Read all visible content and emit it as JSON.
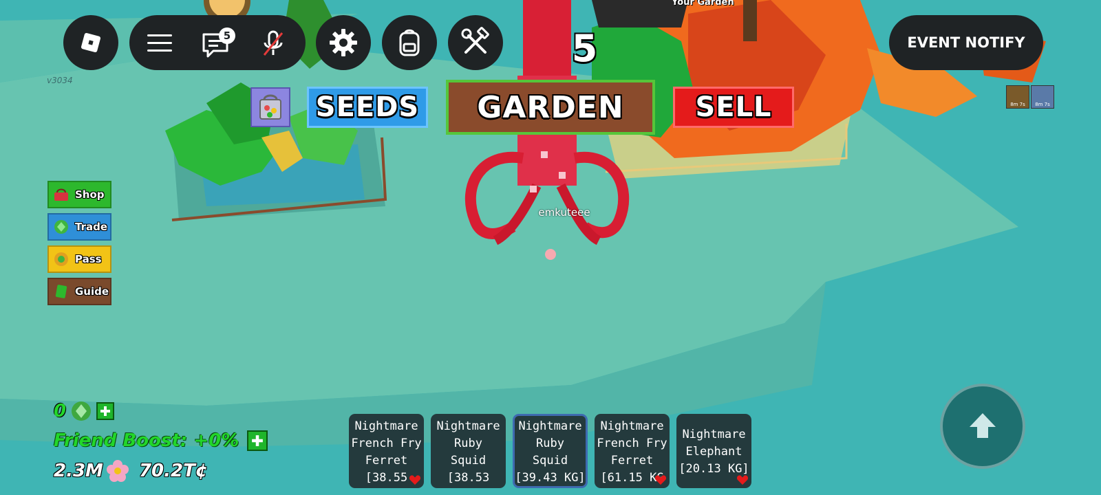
{
  "version": "v3034",
  "player_name": "emkuteee",
  "your_garden_label": "Your Garden",
  "count_display": "5",
  "chat_badge": "5",
  "event_notify_label": "EVENT NOTIFY",
  "nav": {
    "seeds": "SEEDS",
    "garden": "GARDEN",
    "sell": "SELL"
  },
  "side_menu": [
    {
      "label": "Shop",
      "icon": "basket-icon",
      "color": "#2db82d"
    },
    {
      "label": "Trade",
      "icon": "trade-icon",
      "color": "#2f8fd8"
    },
    {
      "label": "Pass",
      "icon": "pass-icon",
      "color": "#f2c316"
    },
    {
      "label": "Guide",
      "icon": "book-icon",
      "color": "#7a4a2c"
    }
  ],
  "stats": {
    "shecklets_token": "0",
    "friend_boost": "Friend Boost: +0%",
    "honey": "2.3M",
    "money": "70.2T¢"
  },
  "hotbar": [
    {
      "lines": [
        "Nightmare",
        "French Fry",
        "Ferret",
        "[38.55"
      ],
      "favorite": true,
      "selected": false
    },
    {
      "lines": [
        "Nightmare",
        "Ruby",
        "Squid",
        "[38.53"
      ],
      "favorite": false,
      "selected": false
    },
    {
      "lines": [
        "Nightmare",
        "Ruby",
        "Squid",
        "[39.43 KG]"
      ],
      "favorite": false,
      "selected": true
    },
    {
      "lines": [
        "Nightmare",
        "French Fry",
        "Ferret",
        "[61.15 KG"
      ],
      "favorite": true,
      "selected": false
    },
    {
      "lines": [
        "Nightmare",
        "Elephant",
        "[20.13 KG]"
      ],
      "favorite": true,
      "selected": false
    }
  ],
  "timers": [
    "8m 7s",
    "8m 7s"
  ],
  "colors": {
    "seeds_blue": "#2f9be8",
    "sell_red": "#e41b1b",
    "garden_brown": "#8a4b2c",
    "friend_boost_green": "#22d62a",
    "ui_dark": "#1f2325"
  }
}
